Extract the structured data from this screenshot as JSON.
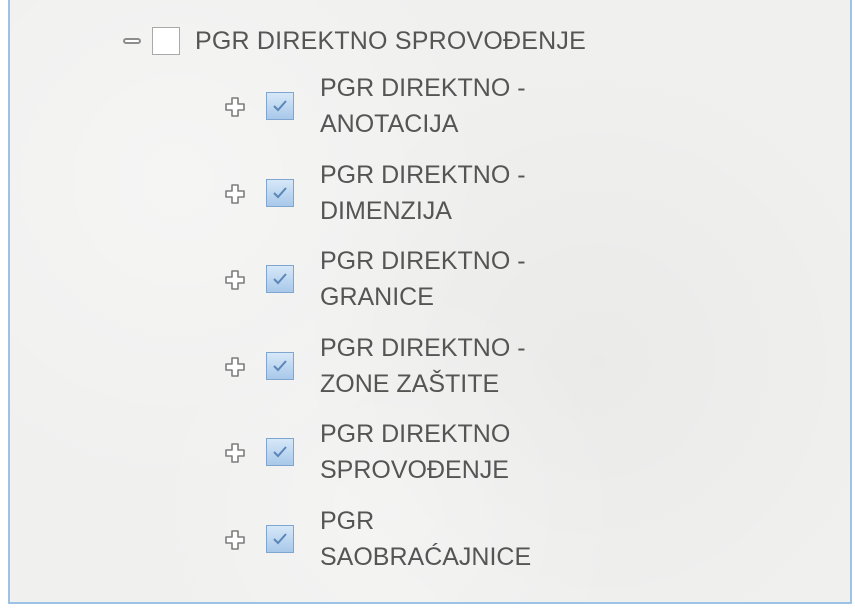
{
  "tree": {
    "root": {
      "label": "PGR DIREKTNO SPROVOĐENJE",
      "expanded": true,
      "checked": false
    },
    "children": [
      {
        "line1": "PGR DIREKTNO -",
        "line2": "ANOTACIJA",
        "checked": true,
        "expanded": false
      },
      {
        "line1": "PGR DIREKTNO -",
        "line2": "DIMENZIJA",
        "checked": true,
        "expanded": false
      },
      {
        "line1": "PGR DIREKTNO -",
        "line2": "GRANICE",
        "checked": true,
        "expanded": false
      },
      {
        "line1": "PGR DIREKTNO -",
        "line2": "ZONE ZAŠTITE",
        "checked": true,
        "expanded": false
      },
      {
        "line1": "PGR DIREKTNO",
        "line2": "SPROVOĐENJE",
        "checked": true,
        "expanded": false
      },
      {
        "line1": "PGR",
        "line2": "SAOBRAĆAJNICE",
        "checked": true,
        "expanded": false
      }
    ]
  },
  "colors": {
    "panel_bg": "#f0f0ef",
    "panel_border": "#9cc3e6",
    "text": "#555555",
    "checkbox_fill": "#b7d3ef",
    "checkbox_border": "#7ea6d1",
    "checkmark": "#5b86b8"
  },
  "icons": {
    "collapse": "minus-icon",
    "expand": "plus-icon",
    "check": "checkmark-icon"
  }
}
